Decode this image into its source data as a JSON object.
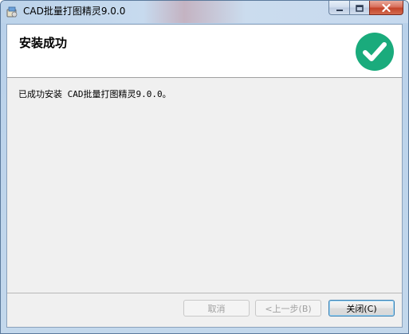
{
  "window": {
    "title": "CAD批量打图精灵9.0.0",
    "icon": "setup-package-icon"
  },
  "caption_buttons": {
    "minimize": "minimize-icon",
    "maximize": "maximize-icon",
    "close": "close-icon"
  },
  "header": {
    "title": "安装成功",
    "status_icon": "checkmark-circle-icon",
    "status_color": "#1aab7c"
  },
  "body": {
    "message": "已成功安装 CAD批量打图精灵9.0.0。"
  },
  "buttons": {
    "cancel": "取消",
    "back": "<上一步(B)",
    "close": "关闭(C)"
  }
}
